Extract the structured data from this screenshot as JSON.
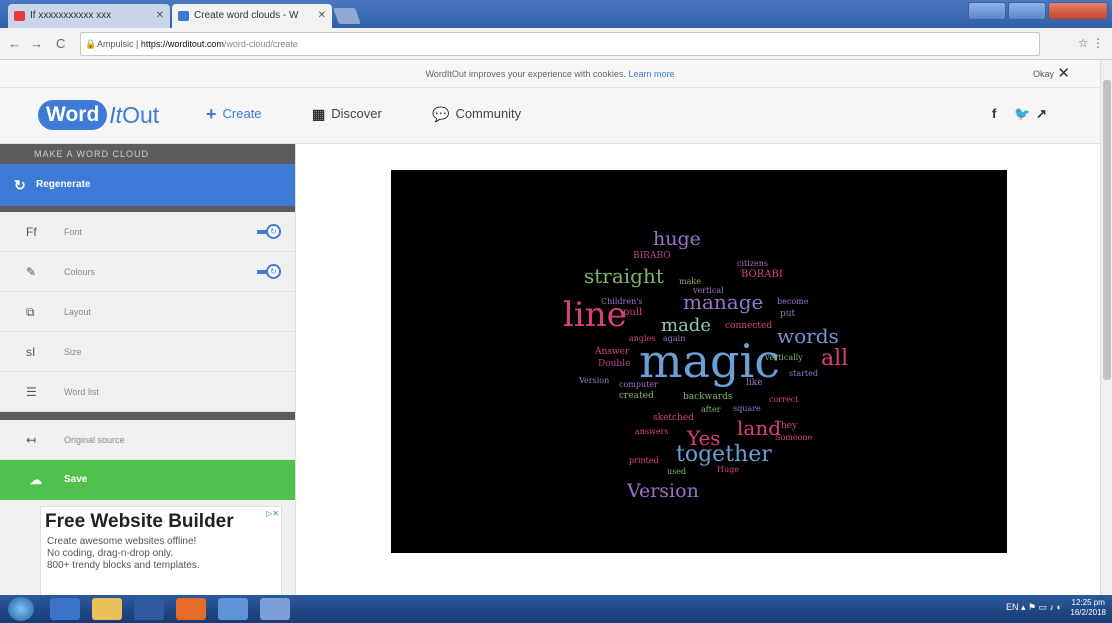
{
  "browser": {
    "tabs": [
      {
        "label": "If xxxxxxxxxxx xxx",
        "favicon_color": "#e53935"
      },
      {
        "label": "Create word clouds - W",
        "favicon_color": "#3d7bd6"
      }
    ],
    "url_prefix": "Ampulsic",
    "url_host": "https://worditout.com",
    "url_path": "/word-cloud/create"
  },
  "cookie_bar": {
    "text": "WordItOut improves your experience with cookies.",
    "link": "Learn more",
    "ok": "Okay"
  },
  "header": {
    "logo_word": "Word",
    "logo_it": "It",
    "logo_out": "Out",
    "nav": [
      {
        "label": "Create",
        "icon": "plus-icon"
      },
      {
        "label": "Discover",
        "icon": "grid-icon"
      },
      {
        "label": "Community",
        "icon": "chat-icon"
      }
    ]
  },
  "sidebar": {
    "heading": "MAKE A WORD CLOUD",
    "regenerate": "Regenerate",
    "items": [
      {
        "label": "Font",
        "icon": "font-icon",
        "toggle": true
      },
      {
        "label": "Colours",
        "icon": "brush-icon",
        "toggle": true
      },
      {
        "label": "Layout",
        "icon": "layout-icon",
        "toggle": false
      },
      {
        "label": "Size",
        "icon": "size-icon",
        "toggle": false
      },
      {
        "label": "Word list",
        "icon": "list-icon",
        "toggle": false
      }
    ],
    "original_source": "Original source",
    "save": "Save"
  },
  "ad": {
    "title": "Free Website Builder",
    "lines": [
      "Create awesome websites offline!",
      "No coding, drag-n-drop only.",
      "800+ trendy blocks and templates."
    ]
  },
  "word_cloud": [
    {
      "text": "huge",
      "color": "#9b73c8"
    },
    {
      "text": "BIRABO",
      "color": "#b24a8a"
    },
    {
      "text": "straight",
      "color": "#7fb56a"
    },
    {
      "text": "line",
      "color": "#d6417e"
    },
    {
      "text": "manage",
      "color": "#9b73c8"
    },
    {
      "text": "made",
      "color": "#8fc8b0"
    },
    {
      "text": "words",
      "color": "#7d8fd6"
    },
    {
      "text": "magic",
      "color": "#6a9fd8"
    },
    {
      "text": "all",
      "color": "#d6417e"
    },
    {
      "text": "Yes",
      "color": "#d6417e"
    },
    {
      "text": "land",
      "color": "#d6417e"
    },
    {
      "text": "together",
      "color": "#6a9fd8"
    },
    {
      "text": "Version",
      "color": "#9b73c8"
    },
    {
      "text": "citizens",
      "color": "#9b73c8"
    },
    {
      "text": "BORABI",
      "color": "#d6417e"
    },
    {
      "text": "make",
      "color": "#7fb56a"
    },
    {
      "text": "vertical",
      "color": "#9b73c8"
    },
    {
      "text": "Children's",
      "color": "#9b73c8"
    },
    {
      "text": "pull",
      "color": "#d6417e"
    },
    {
      "text": "connected",
      "color": "#d6417e"
    },
    {
      "text": "become",
      "color": "#9b73c8"
    },
    {
      "text": "put",
      "color": "#9b73c8"
    },
    {
      "text": "angles",
      "color": "#d6417e"
    },
    {
      "text": "Answer",
      "color": "#d6417e"
    },
    {
      "text": "Double",
      "color": "#b24a8a"
    },
    {
      "text": "vertically",
      "color": "#7fb56a"
    },
    {
      "text": "started",
      "color": "#9b73c8"
    },
    {
      "text": "Version",
      "color": "#9b73c8"
    },
    {
      "text": "computer",
      "color": "#9b73c8"
    },
    {
      "text": "created",
      "color": "#7fb56a"
    },
    {
      "text": "backwards",
      "color": "#7fb56a"
    },
    {
      "text": "correct",
      "color": "#d6417e"
    },
    {
      "text": "sketched",
      "color": "#d6417e"
    },
    {
      "text": "square",
      "color": "#9b73c8"
    },
    {
      "text": "answers",
      "color": "#d6417e"
    },
    {
      "text": "They",
      "color": "#d6417e"
    },
    {
      "text": "Someone",
      "color": "#d6417e"
    },
    {
      "text": "printed",
      "color": "#d6417e"
    },
    {
      "text": "Huge",
      "color": "#d6417e"
    },
    {
      "text": "used",
      "color": "#7fb56a"
    },
    {
      "text": "like",
      "color": "#9b73c8"
    },
    {
      "text": "after",
      "color": "#7fb56a"
    },
    {
      "text": "again",
      "color": "#9b73c8"
    }
  ],
  "taskbar": {
    "lang": "EN",
    "time": "12:25 pm",
    "date": "16/2/2018"
  }
}
